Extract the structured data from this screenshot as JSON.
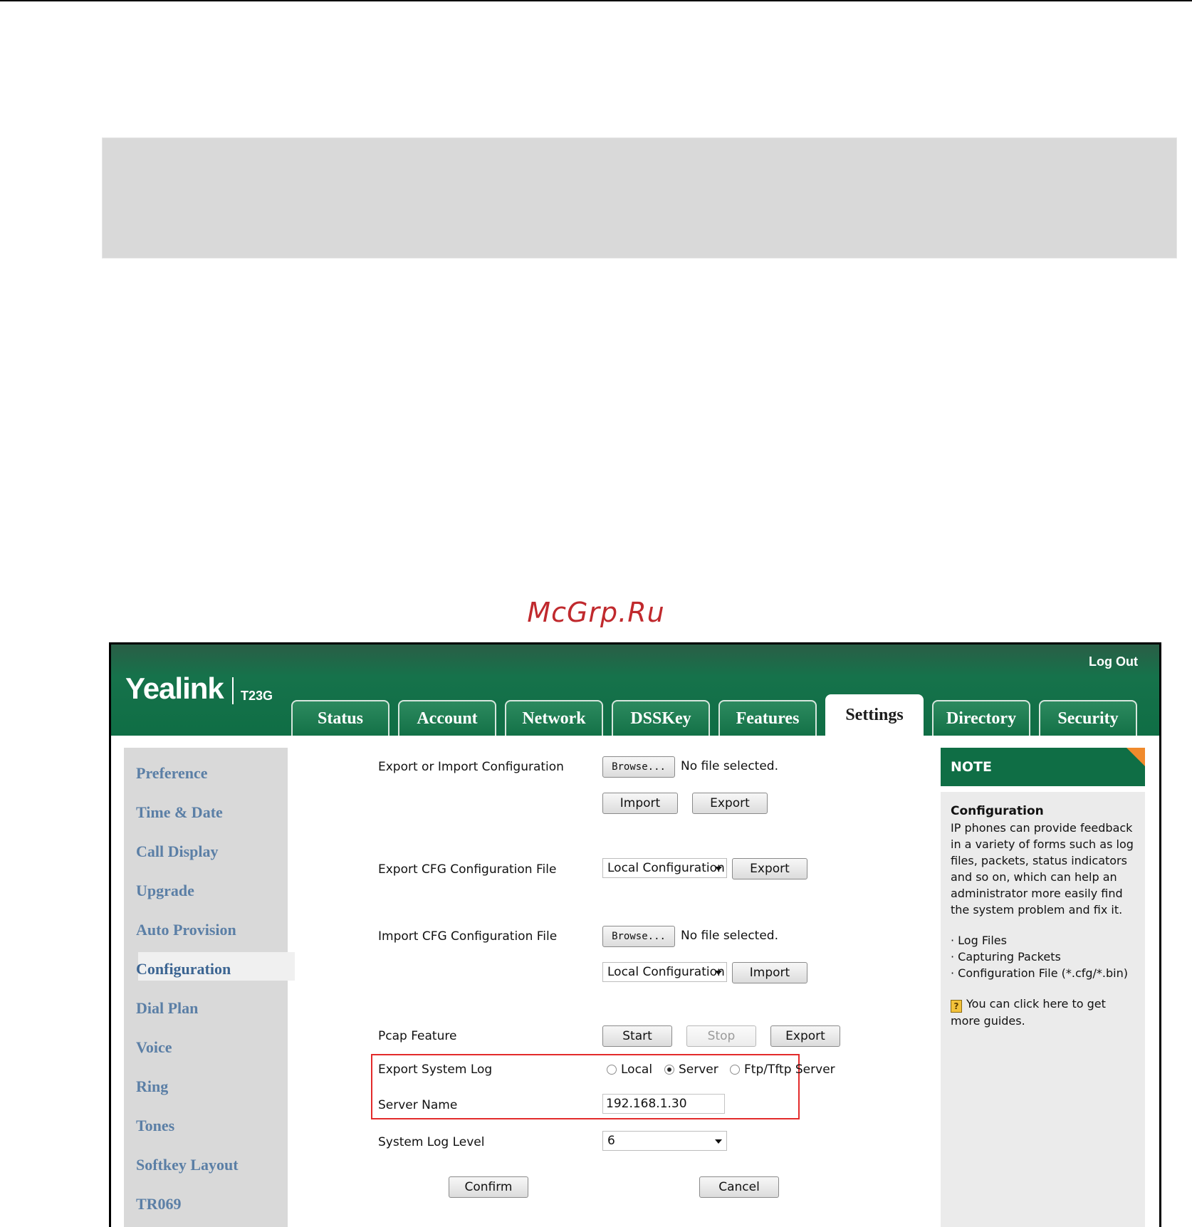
{
  "watermark": "McGrp.Ru",
  "header": {
    "logo": "Yealink",
    "model": "T23G",
    "logout": "Log Out",
    "tabs": [
      "Status",
      "Account",
      "Network",
      "DSSKey",
      "Features",
      "Settings",
      "Directory",
      "Security"
    ],
    "active_tab": "Settings"
  },
  "sidebar": {
    "items": [
      "Preference",
      "Time & Date",
      "Call Display",
      "Upgrade",
      "Auto Provision",
      "Configuration",
      "Dial Plan",
      "Voice",
      "Ring",
      "Tones",
      "Softkey Layout",
      "TR069"
    ],
    "active": "Configuration"
  },
  "form": {
    "export_import_label": "Export or Import Configuration",
    "browse": "Browse...",
    "no_file": "No file selected.",
    "import": "Import",
    "export": "Export",
    "export_cfg_label": "Export CFG Configuration File",
    "local_config": "Local Configuration",
    "import_cfg_label": "Import CFG Configuration File",
    "pcap_label": "Pcap Feature",
    "start": "Start",
    "stop": "Stop",
    "export_syslog_label": "Export System Log",
    "radio_local": "Local",
    "radio_server": "Server",
    "radio_ftp": "Ftp/Tftp Server",
    "radio_selected": "Server",
    "server_name_label": "Server Name",
    "server_name_value": "192.168.1.30",
    "log_level_label": "System Log Level",
    "log_level_value": "6",
    "confirm": "Confirm",
    "cancel": "Cancel"
  },
  "note": {
    "header": "NOTE",
    "title": "Configuration",
    "text": "IP phones can provide feedback in a variety of forms such as log files, packets, status indicators and so on, which can help an administrator more easily find the system problem and fix it.",
    "list": [
      "· Log Files",
      "· Capturing Packets",
      "· Configuration File (*.cfg/*.bin)"
    ],
    "guide": "You can click here to get more guides.",
    "guide_icon": "?"
  },
  "colors": {
    "header_green": "#0f6e45",
    "highlight_red": "#e32b2b",
    "sidebar_link": "#5b7fa6",
    "note_corner": "#f08a2c"
  }
}
